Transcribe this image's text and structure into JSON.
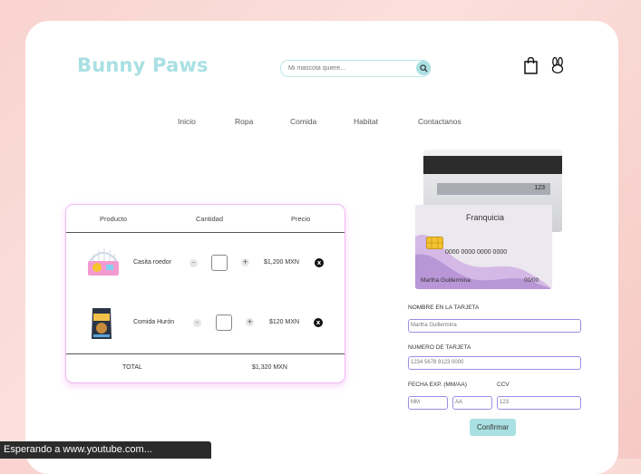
{
  "brand": {
    "name": "Bunny Paws",
    "color": "#a9e0e3"
  },
  "search": {
    "placeholder": "Mi mascota quiere..."
  },
  "icons": {
    "search": "magnifier-icon",
    "cart": "shopping-bag-icon",
    "profile": "bunny-icon"
  },
  "nav": [
    "Inicio",
    "Ropa",
    "Comida",
    "Habitat",
    "Contactanos"
  ],
  "cart": {
    "headers": {
      "product": "Producto",
      "quantity": "Cantidad",
      "price": "Precio"
    },
    "items": [
      {
        "name": "Casita roedor",
        "minus": "-",
        "plus": "+",
        "price": "$1,200 MXN",
        "remove": "x"
      },
      {
        "name": "Comida Hurón",
        "minus": "-",
        "plus": "+",
        "price": "$120 MXN",
        "remove": "x"
      }
    ],
    "total_label": "TOTAL",
    "total_value": "$1,320 MXN"
  },
  "credit_card": {
    "ccv": "123",
    "brand_label": "Franquicia",
    "number": "0000 0000 0000 0000",
    "holder": "Martha Guillermina",
    "expiry": "00/00"
  },
  "form": {
    "name_label": "NOMBRE EN LA TARJETA",
    "name_value": "Martha Guillermina",
    "number_label": "NUMERO DE TARJETA",
    "number_value": "1234 5678 9123 0000",
    "exp_label": "FECHA EXP. (MM/AA)",
    "month_placeholder": "MM",
    "year_placeholder": "AA",
    "ccv_label": "CCV",
    "ccv_value": "123",
    "submit_label": "Confirmar"
  },
  "status_bar": {
    "text": "Esperando a www.youtube.com..."
  }
}
